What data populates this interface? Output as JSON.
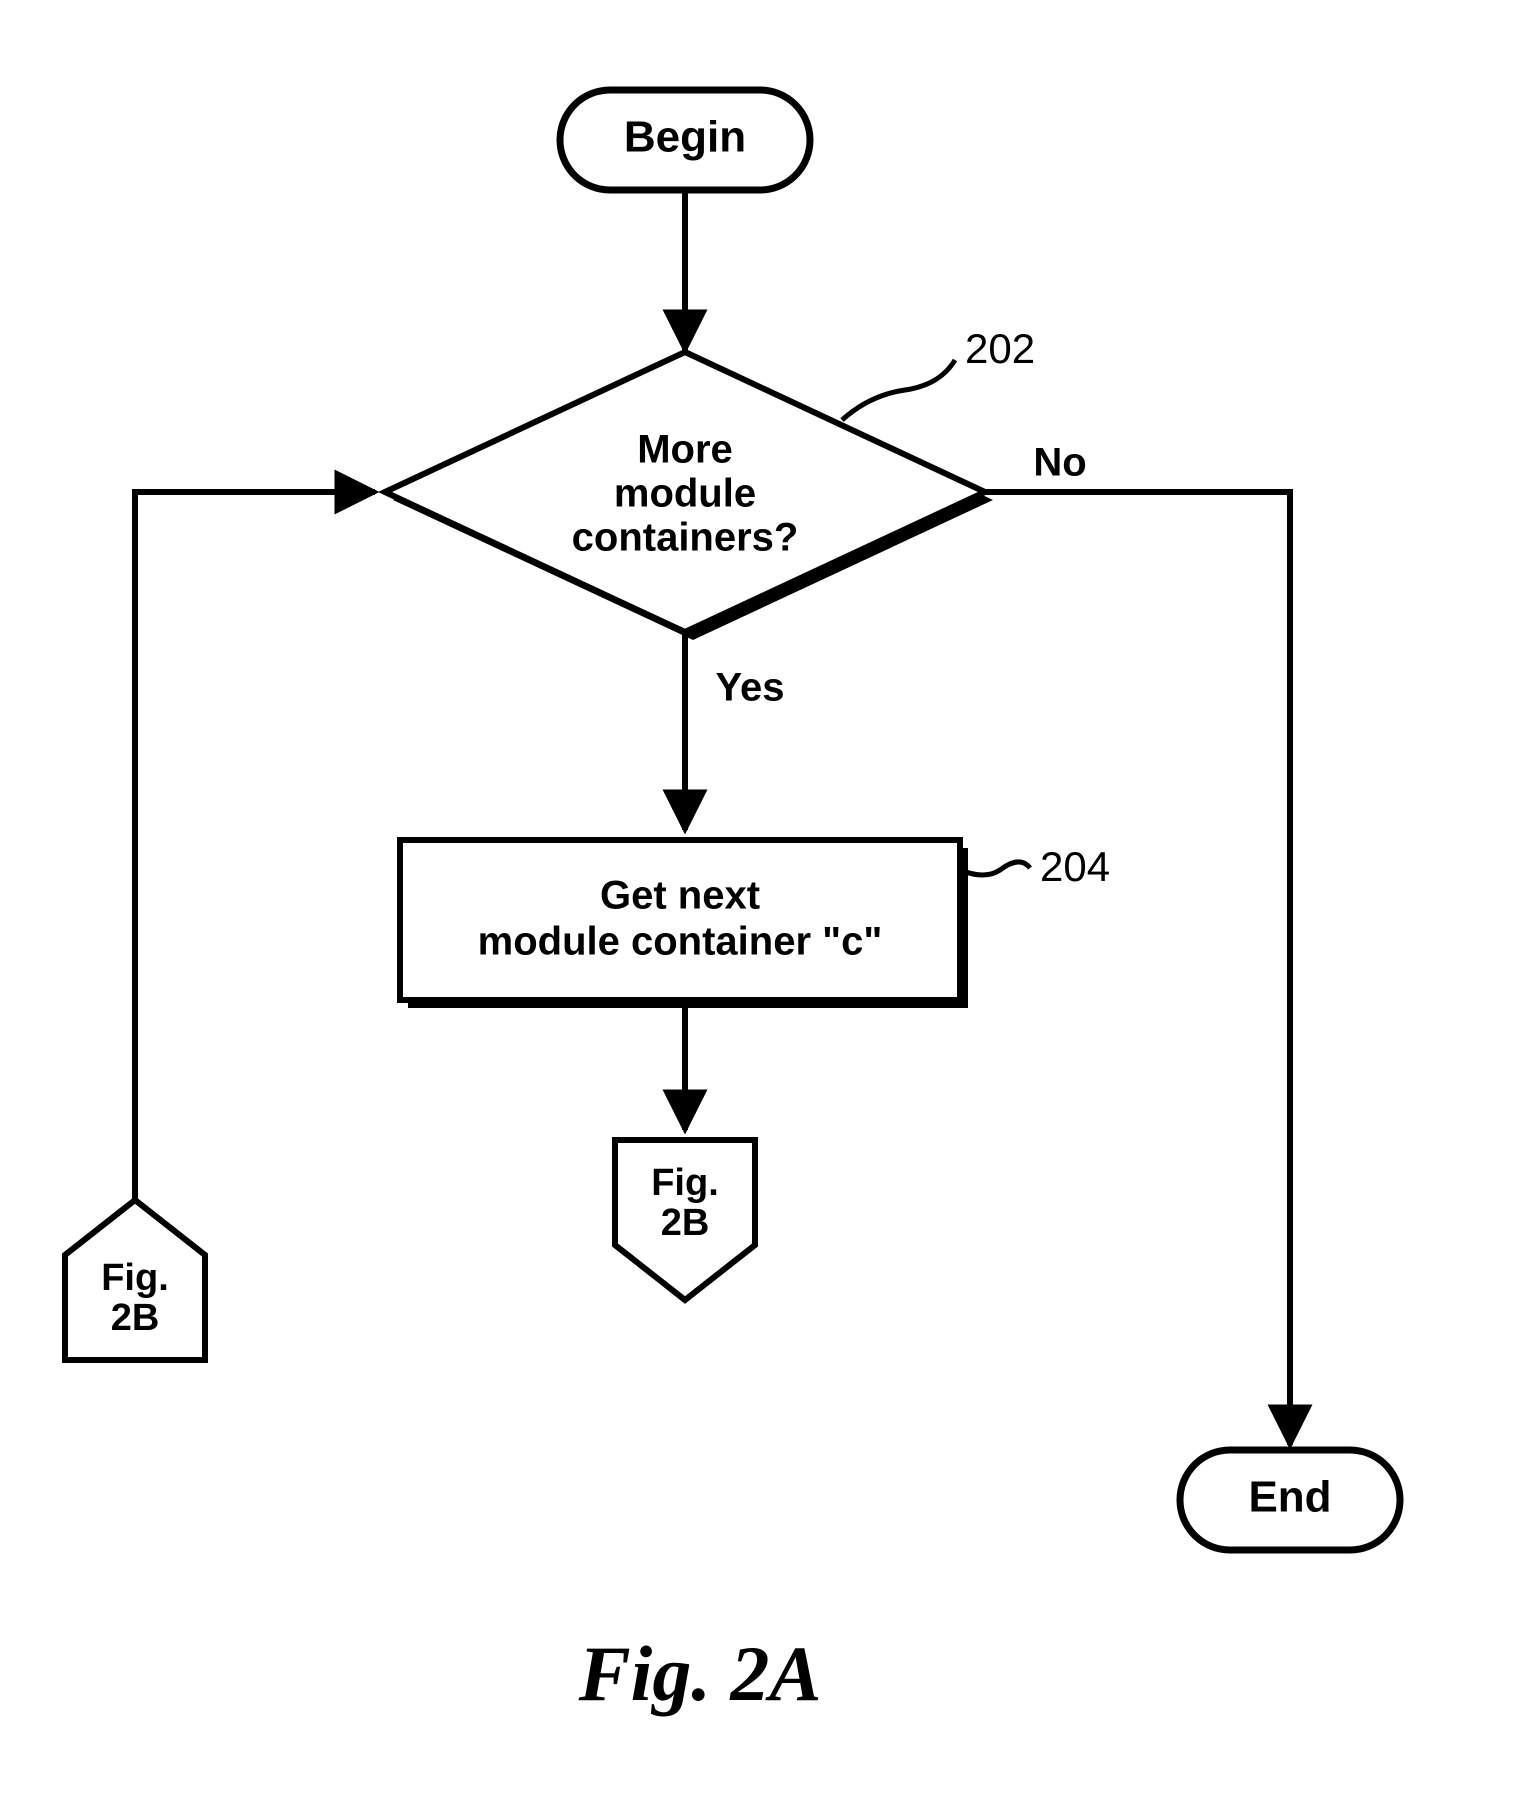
{
  "nodes": {
    "begin": "Begin",
    "decision": {
      "l1": "More",
      "l2": "module",
      "l3": "containers?"
    },
    "process": {
      "l1": "Get next",
      "l2": "module container \"c\""
    },
    "connector_down": {
      "l1": "Fig.",
      "l2": "2B"
    },
    "connector_left": {
      "l1": "Fig.",
      "l2": "2B"
    },
    "end": "End"
  },
  "edges": {
    "yes": "Yes",
    "no": "No"
  },
  "refs": {
    "r202": "202",
    "r204": "204"
  },
  "caption": "Fig. 2A",
  "flow": [
    "Begin",
    {
      "decision": "More module containers?",
      "no": "End",
      "yes": "Get next module container \"c\""
    },
    "→ off-page Fig. 2B",
    "off-page Fig. 2B → (loop back to decision)"
  ]
}
